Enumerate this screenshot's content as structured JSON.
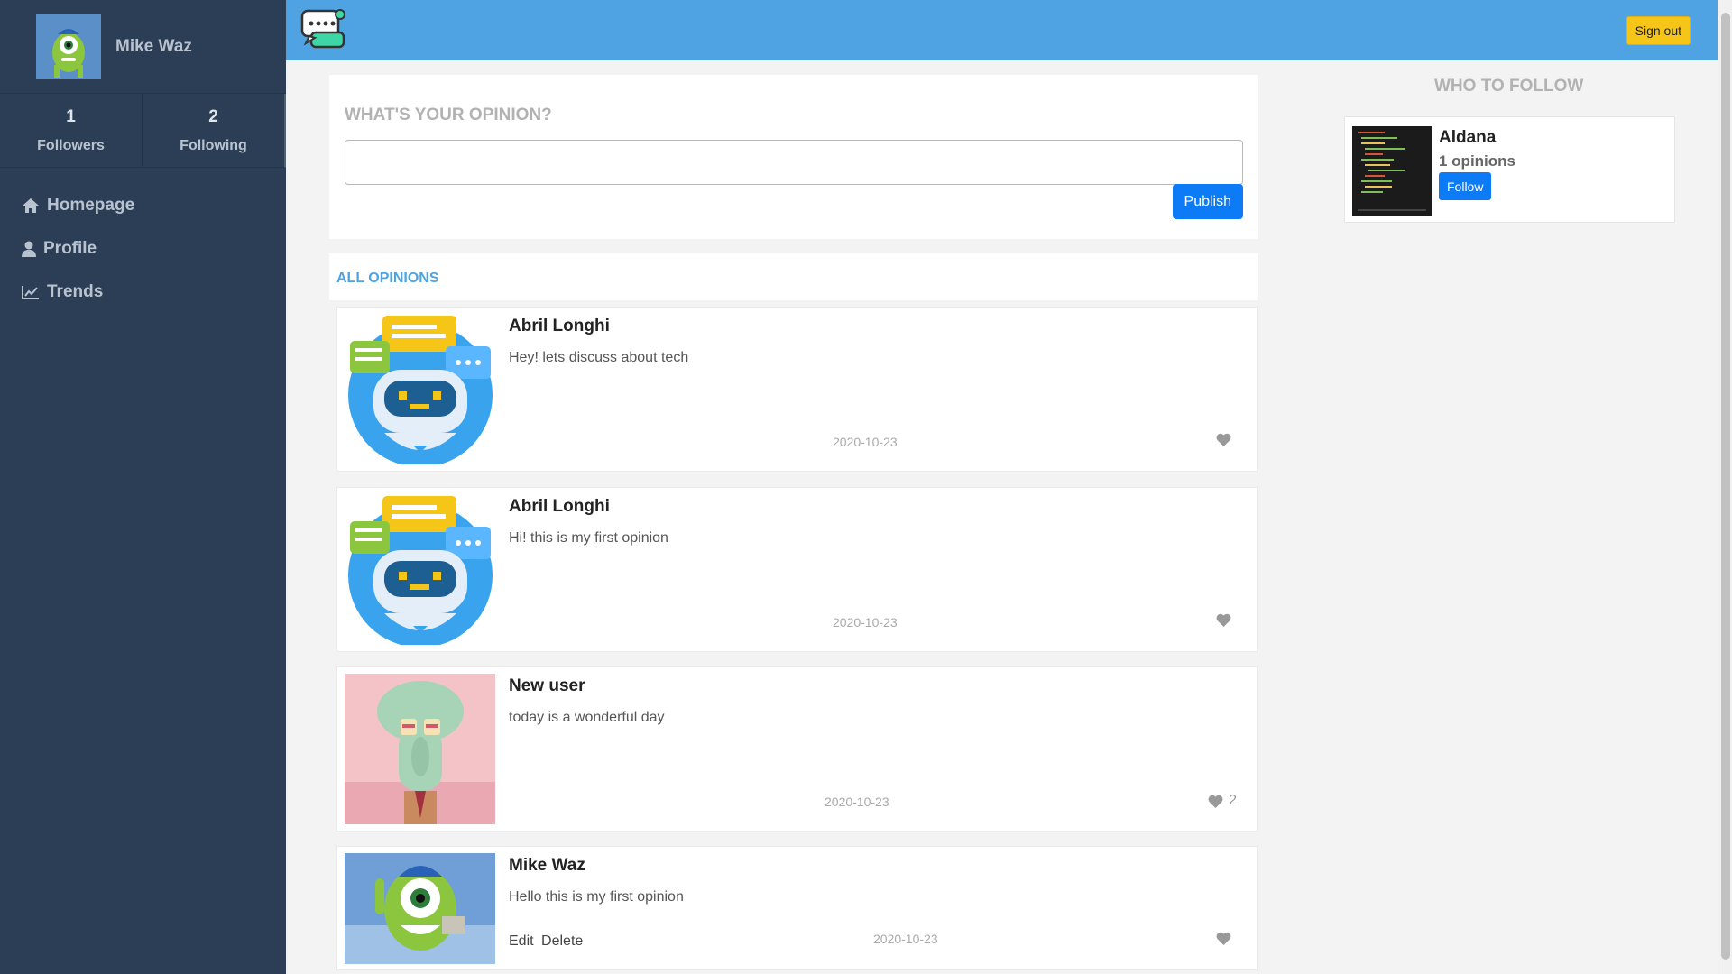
{
  "user": {
    "name": "Mike Waz"
  },
  "stats": {
    "followers_count": "1",
    "followers_label": "Followers",
    "following_count": "2",
    "following_label": "Following"
  },
  "nav": {
    "home": "Homepage",
    "profile": "Profile",
    "trends": "Trends"
  },
  "topbar": {
    "signout": "Sign out"
  },
  "composer": {
    "title": "WHAT'S YOUR OPINION?",
    "input_value": "",
    "publish": "Publish"
  },
  "feed": {
    "title": "ALL OPINIONS",
    "items": [
      {
        "author": "Abril Longhi",
        "text": "Hey! lets discuss about tech",
        "date": "2020-10-23",
        "likes": ""
      },
      {
        "author": "Abril Longhi",
        "text": "Hi! this is my first opinion",
        "date": "2020-10-23",
        "likes": ""
      },
      {
        "author": "New user",
        "text": "today is a wonderful day",
        "date": "2020-10-23",
        "likes": "2"
      },
      {
        "author": "Mike Waz",
        "text": "Hello this is my first opinion",
        "date": "2020-10-23",
        "likes": "",
        "edit": "Edit",
        "delete": "Delete"
      }
    ]
  },
  "who_to_follow": {
    "title": "WHO TO FOLLOW",
    "suggestion": {
      "name": "Aldana",
      "opinions": "1 opinions",
      "follow": "Follow"
    }
  },
  "colors": {
    "sidebar": "#2c3e56",
    "topbar": "#4fa3e3",
    "primary": "#0d7bf5",
    "signout": "#f5c617"
  }
}
